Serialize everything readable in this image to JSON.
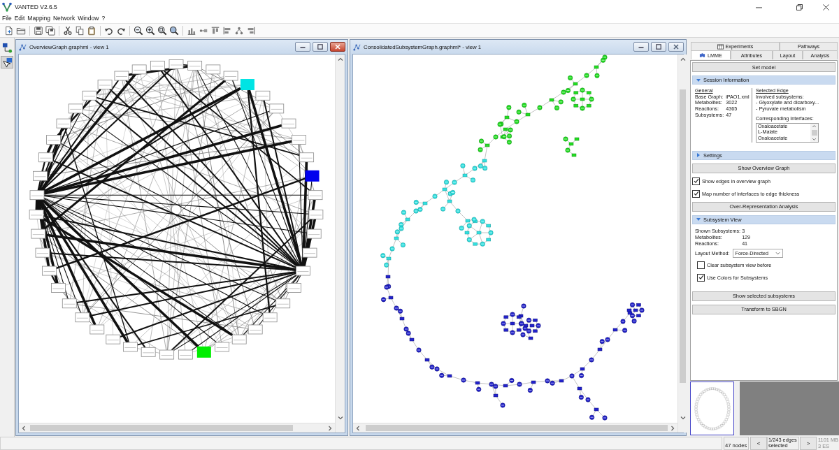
{
  "window": {
    "title": "VANTED V2.6.5"
  },
  "menu": [
    "File",
    "Edit",
    "Mapping",
    "Network",
    "Window",
    "?"
  ],
  "side_tools": [
    {
      "selected": false
    },
    {
      "selected": true
    }
  ],
  "graph_windows": [
    {
      "title": "OverviewGraph.graphml - view 1",
      "active": true,
      "kind": "overview"
    },
    {
      "title": "ConsolidatedSubsystemGraph.graphml* - view 1",
      "active": false,
      "kind": "subsystems"
    }
  ],
  "panel": {
    "tabs_top": [
      {
        "label": "Experiments",
        "selected": false
      },
      {
        "label": "Pathways",
        "selected": false
      }
    ],
    "tabs": [
      {
        "label": "LMME",
        "selected": true
      },
      {
        "label": "Attributes",
        "selected": false
      },
      {
        "label": "Layout",
        "selected": false
      },
      {
        "label": "Analysis",
        "selected": false
      }
    ],
    "items": [
      {
        "kind": "button",
        "label": "Set model"
      },
      {
        "kind": "section",
        "label": "Session Information",
        "expanded": true,
        "body": [
          {
            "kind": "session_info",
            "general": {
              "heading": "General",
              "rows": [
                {
                  "label": "Base Graph:",
                  "value": "iPAO1.xml"
                },
                {
                  "label": "Metabolites:",
                  "value": "3022"
                },
                {
                  "label": "Reactions:",
                  "value": "4365"
                },
                {
                  "label": "Subsystems:",
                  "value": "47"
                }
              ]
            },
            "edge": {
              "heading": "Selected Edge",
              "lines": [
                "Involved subsystems:",
                "- Glyoxylate and dicarboxy...",
                "- Pyruvate metabolism"
              ],
              "list_label": "Corresponding Interfaces:",
              "list": [
                "Oxaloacetate",
                "L-Malate",
                "Oxaloacetate"
              ]
            }
          }
        ]
      },
      {
        "kind": "section",
        "label": "Settings",
        "expanded": false
      },
      {
        "kind": "button",
        "label": "Show Overview Graph"
      },
      {
        "kind": "checkbox",
        "label": "Show edges in overview graph",
        "checked": true
      },
      {
        "kind": "checkbox",
        "label": "Map number of interfaces to edge thickness",
        "checked": true
      },
      {
        "kind": "button",
        "label": "Over-Representation Analysis"
      },
      {
        "kind": "section",
        "label": "Subsystem View",
        "expanded": true,
        "body": [
          {
            "kind": "stats",
            "rows": [
              {
                "label": "Shown Subsystems:",
                "value": "3"
              },
              {
                "label": "Metabolites:",
                "value": "129"
              },
              {
                "label": "Reactions:",
                "value": "41"
              }
            ]
          },
          {
            "kind": "dropdown",
            "label": "Layout Method:",
            "value": "Force-Directed"
          },
          {
            "kind": "checkbox",
            "label": "Clear subsystem view before",
            "checked": false
          },
          {
            "kind": "checkbox",
            "label": "Use Colors for Subsystems",
            "checked": true
          }
        ]
      },
      {
        "kind": "button",
        "label": "Show selected subsystems"
      },
      {
        "kind": "button",
        "label": "Transform to SBGN"
      }
    ]
  },
  "status_bar": {
    "node_count": "47 nodes",
    "prev_button": "<",
    "selection": "1/243 edges selected",
    "next_button": ">",
    "memory": "1101 MB",
    "memory_detail": "3 ES"
  }
}
